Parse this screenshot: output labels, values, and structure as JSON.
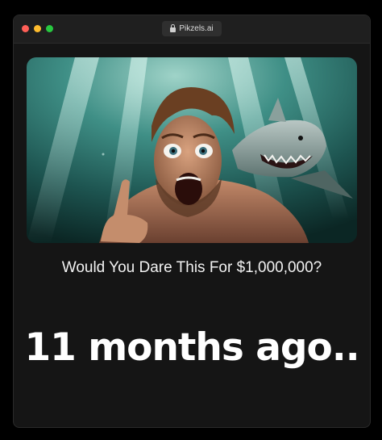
{
  "browser": {
    "url": "Pikzels.ai",
    "controls": [
      "close",
      "minimize",
      "maximize"
    ]
  },
  "thumbnail": {
    "subject": "man-underwater-with-shark",
    "icon": "video-thumbnail"
  },
  "video": {
    "title": "Would You Dare This For $1,000,000?",
    "posted": "11 months ago.."
  },
  "colors": {
    "background": "#000000",
    "window": "#151515",
    "titlebar": "#1f1f1f",
    "text": "#f2f2f2"
  }
}
